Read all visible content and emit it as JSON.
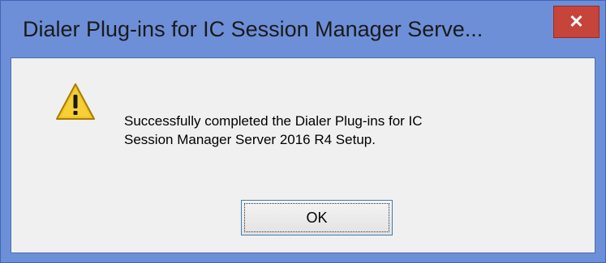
{
  "window": {
    "title": "Dialer Plug-ins for IC Session Manager Serve...",
    "close_symbol": "✕",
    "close_icon": "close-icon"
  },
  "dialog": {
    "icon": "warning-icon",
    "message_line1": "Successfully completed the Dialer Plug-ins for IC",
    "message_line2": "Session Manager Server 2016 R4 Setup.",
    "ok_label": "OK"
  },
  "colors": {
    "titlebar": "#6d8fd8",
    "close_button": "#c7443a",
    "dialog_body": "#f0f0f0",
    "warning_yellow": "#f3c623"
  }
}
